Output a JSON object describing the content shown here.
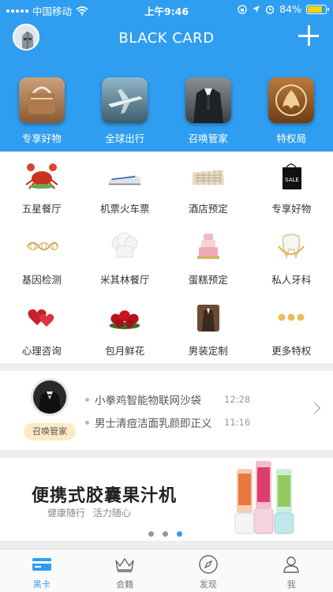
{
  "status_bar": {
    "carrier": "中国移动",
    "time": "上午9:46",
    "battery": "84%",
    "battery_level": 0.84
  },
  "header": {
    "title": "BLACK CARD"
  },
  "top_nav": [
    {
      "label": "专享好物",
      "icon": "handbag-icon"
    },
    {
      "label": "全球出行",
      "icon": "airplane-icon"
    },
    {
      "label": "召唤管家",
      "icon": "suit-icon"
    },
    {
      "label": "特权局",
      "icon": "emblem-icon"
    }
  ],
  "services": [
    {
      "label": "五星餐厅",
      "icon": "crab-icon"
    },
    {
      "label": "机票火车票",
      "icon": "train-icon"
    },
    {
      "label": "酒店预定",
      "icon": "hotel-icon"
    },
    {
      "label": "专享好物",
      "icon": "sale-bag-icon"
    },
    {
      "label": "基因检测",
      "icon": "dna-icon"
    },
    {
      "label": "米其林餐厅",
      "icon": "chef-hat-icon"
    },
    {
      "label": "蛋糕预定",
      "icon": "cake-icon"
    },
    {
      "label": "私人牙科",
      "icon": "tooth-icon"
    },
    {
      "label": "心理咨询",
      "icon": "hearts-icon"
    },
    {
      "label": "包月鲜花",
      "icon": "roses-icon"
    },
    {
      "label": "男装定制",
      "icon": "suit-icon"
    },
    {
      "label": "更多特权",
      "icon": "more-dots-icon"
    }
  ],
  "butler": {
    "tag": "召唤管家",
    "news": [
      {
        "text": "小拳鸡智能物联网沙袋",
        "time": "12:28"
      },
      {
        "text": "男士清痘洁面乳颜即正义",
        "time": "11:16"
      }
    ]
  },
  "banner": {
    "title": "便携式胶囊果汁机",
    "subtitle": "健康随行 活力随心",
    "dots_count": 3,
    "active_dot": 3
  },
  "tabbar": [
    {
      "label": "黑卡",
      "icon": "card-icon",
      "active": true
    },
    {
      "label": "会籍",
      "icon": "crown-icon",
      "active": false
    },
    {
      "label": "发现",
      "icon": "compass-icon",
      "active": false
    },
    {
      "label": "我",
      "icon": "person-icon",
      "active": false
    }
  ],
  "colors": {
    "brand_blue": "#2f9ef0",
    "separator": "#eeeeee",
    "tag_bg": "#fde9c8"
  }
}
